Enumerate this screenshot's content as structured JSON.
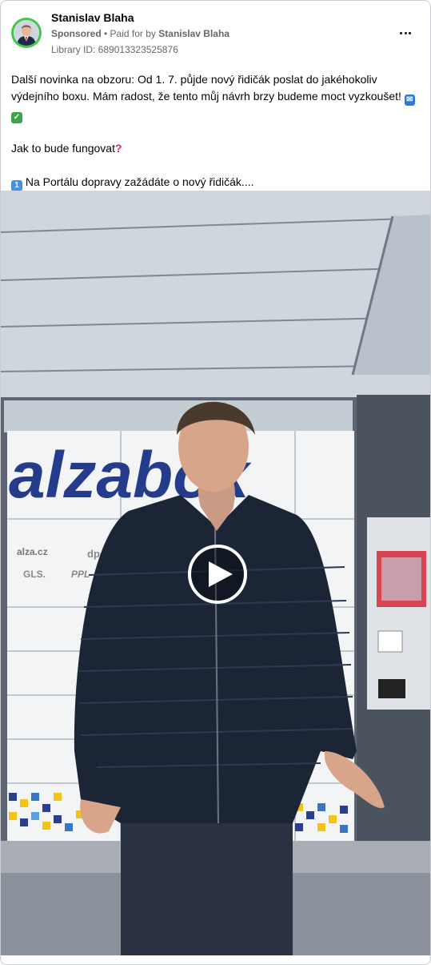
{
  "post": {
    "author": "Stanislav Blaha",
    "sponsored_label": "Sponsored",
    "paid_for_prefix": "• Paid for by",
    "paid_for_name": "Stanislav Blaha",
    "library_id": "Library ID: 689013323525876",
    "more_icon": "more-horizontal-icon",
    "text_line1": "Další novinka na obzoru: Od 1. 7. půjde nový řidičák poslat do jakéhokoliv výdejního boxu. Mám radost, že tento můj návrh brzy budeme moct vyzkoušet!",
    "text_line2": "Jak to bude fungovat",
    "text_line3": "Na Portálu dopravy zažádáte o nový řidičák...."
  },
  "video": {
    "sign_text": "alzabox",
    "logo_labels": [
      "alza.cz",
      "dpd",
      "GLS.",
      "PPL"
    ],
    "play_icon": "play-icon"
  },
  "colors": {
    "avatar_ring": "#3fc94a",
    "sign_blue": "#253c8c",
    "check_green": "#3aa54a",
    "mailbox_blue": "#2e7bd6",
    "keycap_blue": "#4a8fe0"
  }
}
